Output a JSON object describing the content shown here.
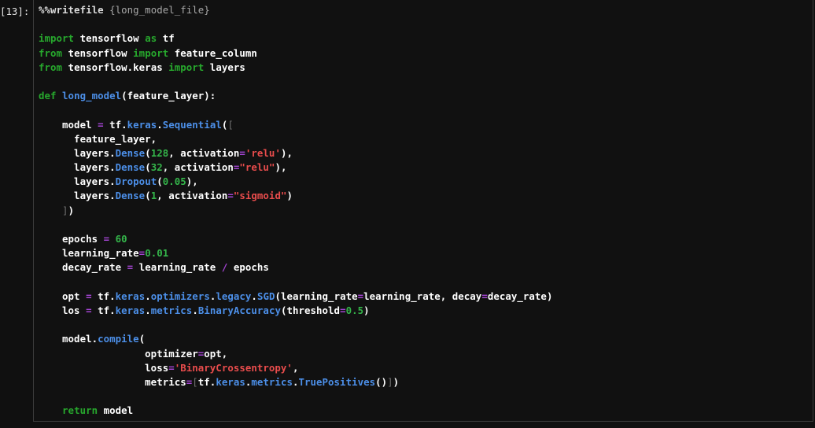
{
  "prompt": "[13]:",
  "colors": {
    "background": "#111111",
    "keyword": "#27a82d",
    "builtin_attr": "#4c8fe8",
    "number": "#34b54a",
    "string": "#e84c4c",
    "operator": "#a545d4",
    "text": "#ffffff"
  },
  "code_lines": [
    [
      {
        "t": "%%writefile ",
        "c": "mag"
      },
      {
        "t": "{long_model_file}",
        "c": "brace"
      }
    ],
    [],
    [
      {
        "t": "import",
        "c": "kw"
      },
      {
        "t": " tensorflow "
      },
      {
        "t": "as",
        "c": "kw"
      },
      {
        "t": " tf"
      }
    ],
    [
      {
        "t": "from",
        "c": "kw"
      },
      {
        "t": " tensorflow "
      },
      {
        "t": "import",
        "c": "kw"
      },
      {
        "t": " feature_column"
      }
    ],
    [
      {
        "t": "from",
        "c": "kw"
      },
      {
        "t": " tensorflow.keras "
      },
      {
        "t": "import",
        "c": "kw"
      },
      {
        "t": " layers"
      }
    ],
    [],
    [
      {
        "t": "def",
        "c": "kw"
      },
      {
        "t": " "
      },
      {
        "t": "long_model",
        "c": "fn"
      },
      {
        "t": "(feature_layer):"
      }
    ],
    [],
    [
      {
        "t": "    model "
      },
      {
        "t": "=",
        "c": "op"
      },
      {
        "t": " tf."
      },
      {
        "t": "keras",
        "c": "fn"
      },
      {
        "t": "."
      },
      {
        "t": "Sequential",
        "c": "fn"
      },
      {
        "t": "("
      },
      {
        "t": "[",
        "c": "brk"
      }
    ],
    [
      {
        "t": "      feature_layer,"
      }
    ],
    [
      {
        "t": "      layers."
      },
      {
        "t": "Dense",
        "c": "fn"
      },
      {
        "t": "("
      },
      {
        "t": "128",
        "c": "num"
      },
      {
        "t": ", activation"
      },
      {
        "t": "=",
        "c": "op"
      },
      {
        "t": "'relu'",
        "c": "str"
      },
      {
        "t": "),"
      }
    ],
    [
      {
        "t": "      layers."
      },
      {
        "t": "Dense",
        "c": "fn"
      },
      {
        "t": "("
      },
      {
        "t": "32",
        "c": "num"
      },
      {
        "t": ", activation"
      },
      {
        "t": "=",
        "c": "op"
      },
      {
        "t": "\"relu\"",
        "c": "str"
      },
      {
        "t": "),"
      }
    ],
    [
      {
        "t": "      layers."
      },
      {
        "t": "Dropout",
        "c": "fn"
      },
      {
        "t": "("
      },
      {
        "t": "0.05",
        "c": "num"
      },
      {
        "t": "),"
      }
    ],
    [
      {
        "t": "      layers."
      },
      {
        "t": "Dense",
        "c": "fn"
      },
      {
        "t": "("
      },
      {
        "t": "1",
        "c": "num"
      },
      {
        "t": ", activation"
      },
      {
        "t": "=",
        "c": "op"
      },
      {
        "t": "\"sigmoid\"",
        "c": "str"
      },
      {
        "t": ")"
      }
    ],
    [
      {
        "t": "    "
      },
      {
        "t": "]",
        "c": "brk"
      },
      {
        "t": ")"
      }
    ],
    [],
    [
      {
        "t": "    epochs "
      },
      {
        "t": "=",
        "c": "op"
      },
      {
        "t": " "
      },
      {
        "t": "60",
        "c": "num"
      }
    ],
    [
      {
        "t": "    learning_rate"
      },
      {
        "t": "=",
        "c": "op"
      },
      {
        "t": "0.01",
        "c": "num"
      }
    ],
    [
      {
        "t": "    decay_rate "
      },
      {
        "t": "=",
        "c": "op"
      },
      {
        "t": " learning_rate "
      },
      {
        "t": "/",
        "c": "op"
      },
      {
        "t": " epochs"
      }
    ],
    [],
    [
      {
        "t": "    opt "
      },
      {
        "t": "=",
        "c": "op"
      },
      {
        "t": " tf."
      },
      {
        "t": "keras",
        "c": "fn"
      },
      {
        "t": "."
      },
      {
        "t": "optimizers",
        "c": "fn"
      },
      {
        "t": "."
      },
      {
        "t": "legacy",
        "c": "fn"
      },
      {
        "t": "."
      },
      {
        "t": "SGD",
        "c": "fn"
      },
      {
        "t": "(learning_rate"
      },
      {
        "t": "=",
        "c": "op"
      },
      {
        "t": "learning_rate, decay"
      },
      {
        "t": "=",
        "c": "op"
      },
      {
        "t": "decay_rate)"
      }
    ],
    [
      {
        "t": "    los "
      },
      {
        "t": "=",
        "c": "op"
      },
      {
        "t": " tf."
      },
      {
        "t": "keras",
        "c": "fn"
      },
      {
        "t": "."
      },
      {
        "t": "metrics",
        "c": "fn"
      },
      {
        "t": "."
      },
      {
        "t": "BinaryAccuracy",
        "c": "fn"
      },
      {
        "t": "(threshold"
      },
      {
        "t": "=",
        "c": "op"
      },
      {
        "t": "0.5",
        "c": "num"
      },
      {
        "t": ")"
      }
    ],
    [],
    [
      {
        "t": "    model."
      },
      {
        "t": "compile",
        "c": "fn"
      },
      {
        "t": "("
      }
    ],
    [
      {
        "t": "                  optimizer"
      },
      {
        "t": "=",
        "c": "op"
      },
      {
        "t": "opt,"
      }
    ],
    [
      {
        "t": "                  loss"
      },
      {
        "t": "=",
        "c": "op"
      },
      {
        "t": "'BinaryCrossentropy'",
        "c": "str"
      },
      {
        "t": ","
      }
    ],
    [
      {
        "t": "                  metrics"
      },
      {
        "t": "=",
        "c": "op"
      },
      {
        "t": "[",
        "c": "brk"
      },
      {
        "t": "tf."
      },
      {
        "t": "keras",
        "c": "fn"
      },
      {
        "t": "."
      },
      {
        "t": "metrics",
        "c": "fn"
      },
      {
        "t": "."
      },
      {
        "t": "TruePositives",
        "c": "fn"
      },
      {
        "t": "()"
      },
      {
        "t": "]",
        "c": "brk"
      },
      {
        "t": ")"
      }
    ],
    [],
    [
      {
        "t": "    "
      },
      {
        "t": "return",
        "c": "kw"
      },
      {
        "t": " model"
      }
    ]
  ]
}
